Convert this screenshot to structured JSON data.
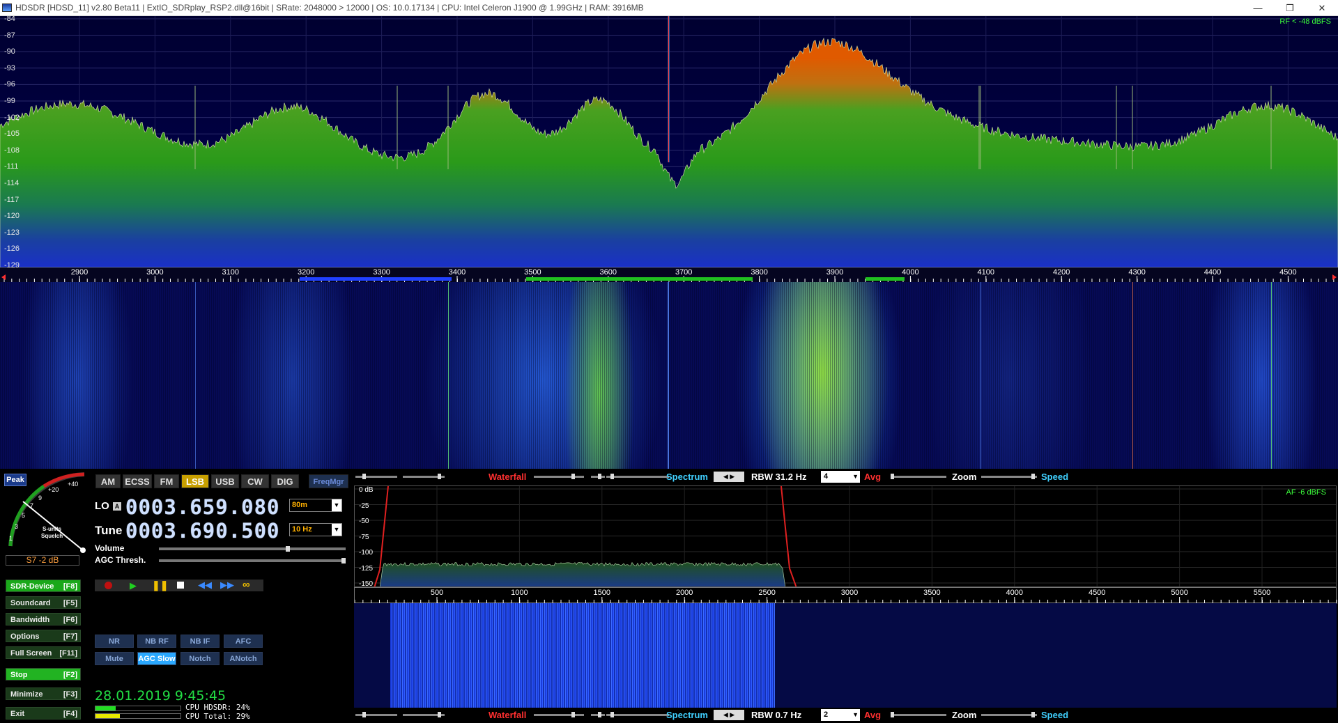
{
  "titlebar": {
    "text": "HDSDR  [HDSD_11]  v2.80 Beta11  |  ExtIO_SDRplay_RSP2.dll@16bit  |  SRate: 2048000 > 12000  |  OS: 10.0.17134   |  CPU: Intel Celeron  J1900  @ 1.99GHz  |  RAM: 3916MB",
    "minimize": "—",
    "restore": "❐",
    "close": "✕"
  },
  "spectrum": {
    "db_labels": [
      "-84",
      "-87",
      "-90",
      "-93",
      "-96",
      "-99",
      "-102",
      "-105",
      "-108",
      "-111",
      "-114",
      "-117",
      "-120",
      "-123",
      "-126",
      "-129"
    ],
    "rf_readout": "RF < -48 dBFS"
  },
  "freq_scale": {
    "labels": [
      "2900",
      "3000",
      "3100",
      "3200",
      "3300",
      "3400",
      "3500",
      "3600",
      "3700",
      "3800",
      "3900",
      "4000",
      "4100",
      "4200",
      "4300",
      "4400",
      "4500"
    ]
  },
  "modes": [
    "AM",
    "ECSS",
    "FM",
    "LSB",
    "USB",
    "CW",
    "DIG"
  ],
  "active_mode": "LSB",
  "freqmgr": "FreqMgr",
  "meter": {
    "peak_label": "Peak",
    "scale": [
      "1",
      "3",
      "5",
      "7",
      "9",
      "+20",
      "+40"
    ],
    "squelch_label": "S-units\nSquelch",
    "reading": "S7 -2 dB"
  },
  "lo": {
    "label": "LO",
    "badge": "A",
    "value": "0003.659.080",
    "band": "80m"
  },
  "tune": {
    "label": "Tune",
    "value": "0003.690.500",
    "step": "10 Hz"
  },
  "volume_label": "Volume",
  "agc_thresh_label": "AGC Thresh.",
  "side_buttons": [
    {
      "label": "SDR-Device",
      "key": "[F8]"
    },
    {
      "label": "Soundcard",
      "key": "[F5]"
    },
    {
      "label": "Bandwidth",
      "key": "[F6]"
    },
    {
      "label": "Options",
      "key": "[F7]"
    },
    {
      "label": "Full Screen",
      "key": "[F11]"
    },
    {
      "label": "Stop",
      "key": "[F2]"
    },
    {
      "label": "Minimize",
      "key": "[F3]"
    },
    {
      "label": "Exit",
      "key": "[F4]"
    }
  ],
  "dsp": {
    "row1": [
      "NR",
      "NB RF",
      "NB IF",
      "AFC"
    ],
    "row2": [
      "Mute",
      "AGC Slow",
      "Notch",
      "ANotch"
    ]
  },
  "datetime": "28.01.2019 9:45:45",
  "cpu": {
    "hdsdr": "CPU HDSDR: 24%",
    "total": "CPU Total: 29%",
    "hdsdr_pct": 24,
    "total_pct": 29
  },
  "rf_controls": {
    "waterfall": "Waterfall",
    "spectrum": "Spectrum",
    "rbw": "RBW 31.2 Hz",
    "avg_value": "4",
    "avg": "Avg",
    "zoom": "Zoom",
    "speed": "Speed"
  },
  "af_controls": {
    "waterfall": "Waterfall",
    "spectrum": "Spectrum",
    "rbw": "RBW   0.7 Hz",
    "avg_value": "2",
    "avg": "Avg",
    "zoom": "Zoom",
    "speed": "Speed"
  },
  "af": {
    "readout": "AF  -6 dBFS",
    "db_labels": [
      "0 dB",
      "-25",
      "-50",
      "-75",
      "-100",
      "-125",
      "-150"
    ],
    "freq_labels": [
      "500",
      "1000",
      "1500",
      "2000",
      "2500",
      "3000",
      "3500",
      "4000",
      "4500",
      "5000",
      "5500"
    ]
  },
  "colors": {
    "spectrum_fill_top": "#d86a00",
    "spectrum_fill_mid": "#2ea81a",
    "spectrum_bg": "#000040",
    "active_mode": "#c8a000",
    "datetime": "#22dd44",
    "waterfall_label": "#ff3030",
    "spectrum_label": "#40d0ff",
    "avg_label": "#ff3030"
  }
}
